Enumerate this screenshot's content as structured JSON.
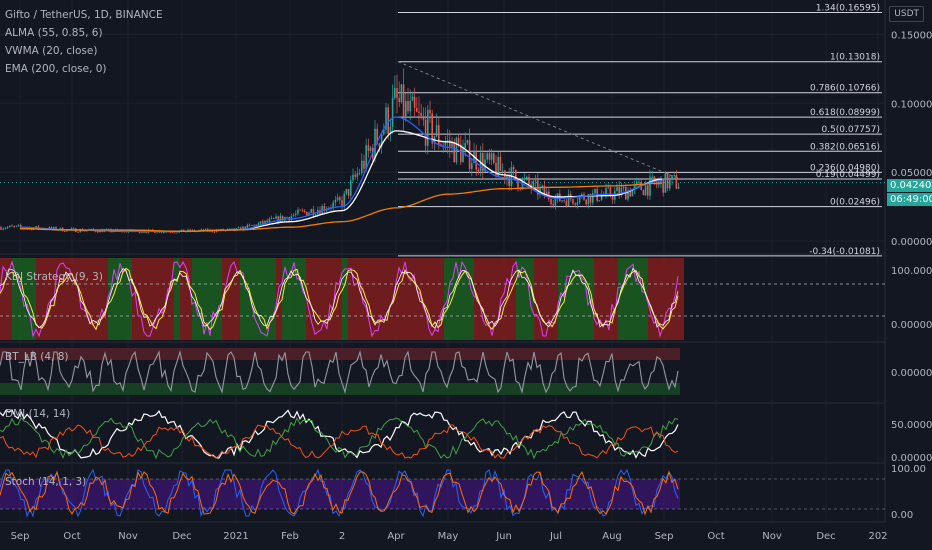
{
  "header": {
    "symbol": "Gifto / TetherUS, 1D, BINANCE",
    "indicators": [
      "ALMA (55, 0.85, 6)",
      "VWMA (20, close)",
      "EMA (200, close, 0)"
    ],
    "unit_button": "USDT"
  },
  "price_tag": {
    "price": "0.04240",
    "countdown": "06:49:00",
    "color": "#26a69a"
  },
  "fib_levels": [
    {
      "label": "1.34(0.16595)",
      "value": 0.16595
    },
    {
      "label": "1(0.13018)",
      "value": 0.13018
    },
    {
      "label": "0.786(0.10766)",
      "value": 0.10766
    },
    {
      "label": "0.618(0.08999)",
      "value": 0.08999
    },
    {
      "label": "0.5(0.07757)",
      "value": 0.07757
    },
    {
      "label": "0.382(0.06516)",
      "value": 0.06516
    },
    {
      "label": "0.236(0.04980)",
      "value": 0.0498
    },
    {
      "label": "0.19(0.04499)",
      "value": 0.04499
    },
    {
      "label": "0(0.02496)",
      "value": 0.02496
    },
    {
      "label": "-0.34(-0.01081)",
      "value": -0.01081
    }
  ],
  "panes": [
    {
      "id": "kdj",
      "title": "KDJ Strategy (9, 3)",
      "ticks": [
        "100.00000",
        "0.00000"
      ]
    },
    {
      "id": "btlb",
      "title": "BT_LB (4, 8)",
      "ticks": [
        "0.00000"
      ]
    },
    {
      "id": "dmi",
      "title": "DMI (14, 14)",
      "ticks": [
        "50.00000",
        "0.00000"
      ]
    },
    {
      "id": "stoch",
      "title": "Stoch (14, 1, 3)",
      "ticks": [
        "100.00",
        "0.00"
      ]
    }
  ],
  "x_axis": [
    "Sep",
    "Oct",
    "Nov",
    "Dec",
    "2021",
    "Feb",
    "2",
    "Apr",
    "May",
    "Jun",
    "Jul",
    "Aug",
    "Sep",
    "Oct",
    "Nov",
    "Dec",
    "202"
  ],
  "chart_data": {
    "type": "line",
    "title": "Gifto / TetherUS, 1D, BINANCE",
    "y_axis_ticks": [
      0.15,
      0.1,
      0.05,
      0.0
    ],
    "ylim": [
      -0.008,
      0.175
    ],
    "grid": true,
    "series": [
      {
        "name": "Gifto / TetherUS",
        "color": "#26a69a",
        "x": [
          "Sep",
          "Oct",
          "Nov",
          "Dec",
          "2021",
          "Feb",
          "2",
          "Apr",
          "May",
          "Jun",
          "Jul",
          "Aug",
          "Sep"
        ],
        "values": [
          0.01,
          0.008,
          0.007,
          0.007,
          0.008,
          0.018,
          0.028,
          0.1,
          0.07,
          0.05,
          0.03,
          0.034,
          0.0424
        ]
      },
      {
        "name": "ALMA (55, 0.85, 6)",
        "color": "#ffffff",
        "x": [
          "Sep",
          "Oct",
          "Nov",
          "Dec",
          "2021",
          "Feb",
          "2",
          "Apr",
          "May",
          "Jun",
          "Jul",
          "Aug",
          "Sep"
        ],
        "values": [
          0.009,
          0.008,
          0.007,
          0.007,
          0.008,
          0.014,
          0.022,
          0.08,
          0.072,
          0.048,
          0.032,
          0.033,
          0.045
        ]
      },
      {
        "name": "VWMA (20, close)",
        "color": "#2962ff",
        "x": [
          "Sep",
          "Oct",
          "Nov",
          "Dec",
          "2021",
          "Feb",
          "2",
          "Apr",
          "May",
          "Jun",
          "Jul",
          "Aug",
          "Sep"
        ],
        "values": [
          0.01,
          0.008,
          0.007,
          0.007,
          0.008,
          0.016,
          0.025,
          0.09,
          0.068,
          0.046,
          0.031,
          0.034,
          0.044
        ]
      },
      {
        "name": "EMA (200, close, 0)",
        "color": "#f57c00",
        "x": [
          "Sep",
          "Oct",
          "Nov",
          "Dec",
          "2021",
          "Feb",
          "2",
          "Apr",
          "May",
          "Jun",
          "Jul",
          "Aug",
          "Sep"
        ],
        "values": [
          0.009,
          0.008,
          0.008,
          0.007,
          0.008,
          0.01,
          0.014,
          0.024,
          0.034,
          0.038,
          0.039,
          0.04,
          0.042
        ]
      }
    ]
  }
}
